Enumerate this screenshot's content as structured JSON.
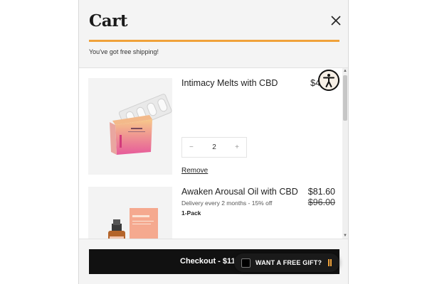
{
  "cart": {
    "title": "Cart",
    "shipping_message": "You've got free shipping!",
    "progress_fraction": 1.0,
    "colors": {
      "progress": "#f0a23a",
      "checkout_bg": "#111111"
    }
  },
  "items": [
    {
      "name": "Intimacy Melts with CBD",
      "price": "$40",
      "quantity": "2",
      "decrement_icon": "minus-icon",
      "increment_icon": "plus-icon",
      "remove_label": "Remove"
    },
    {
      "name": "Awaken Arousal Oil with CBD",
      "price": "$81.60",
      "original_price": "$96.00",
      "delivery": "Delivery every 2 months - 15% off",
      "pack": "1-Pack"
    }
  ],
  "footer": {
    "checkout_label": "Checkout - $111",
    "gift_label": "WANT A FREE GIFT?"
  },
  "icons": {
    "close": "close-icon",
    "accessibility": "accessibility-icon",
    "scroll_up": "scroll-up-arrow",
    "scroll_down": "scroll-down-arrow"
  }
}
